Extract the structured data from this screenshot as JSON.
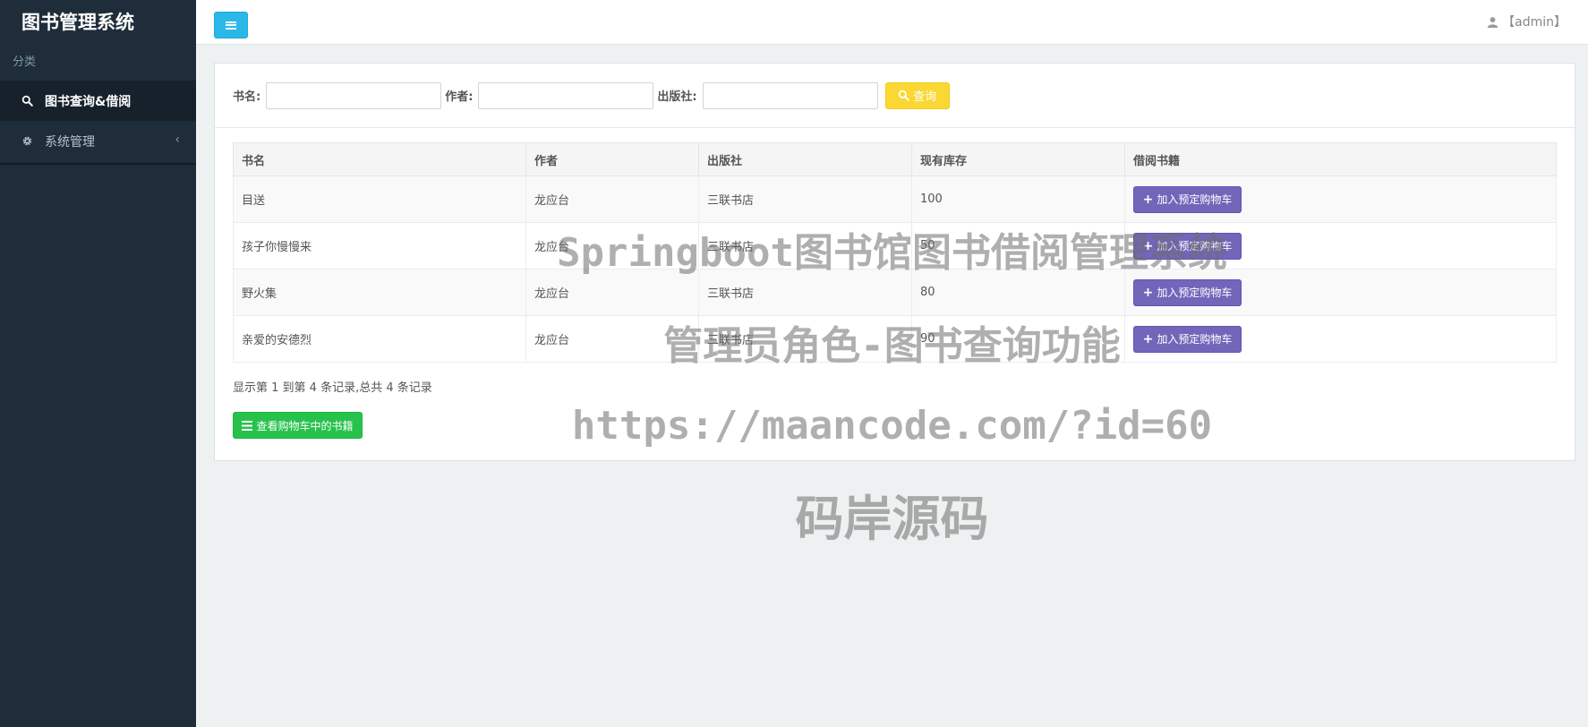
{
  "sidebar": {
    "brand": "图书管理系统",
    "section_label": "分类",
    "items": [
      {
        "label": "图书查询&借阅",
        "icon": "search-icon",
        "active": true
      },
      {
        "label": "系统管理",
        "icon": "gear-icon",
        "chevron": "‹"
      }
    ]
  },
  "header": {
    "toggle_icon": "menu-icon",
    "user_label": "【admin】"
  },
  "search": {
    "title_label": "书名:",
    "title_value": "",
    "author_label": "作者:",
    "author_value": "",
    "publisher_label": "出版社:",
    "publisher_value": "",
    "query_button": "查询"
  },
  "table": {
    "columns": [
      "书名",
      "作者",
      "出版社",
      "现有库存",
      "借阅书籍"
    ],
    "rows": [
      {
        "title": "目送",
        "author": "龙应台",
        "publisher": "三联书店",
        "stock": "100",
        "action": "加入预定购物车"
      },
      {
        "title": "孩子你慢慢来",
        "author": "龙应台",
        "publisher": "三联书店",
        "stock": "50",
        "action": "加入预定购物车"
      },
      {
        "title": "野火集",
        "author": "龙应台",
        "publisher": "三联书店",
        "stock": "80",
        "action": "加入预定购物车"
      },
      {
        "title": "亲爱的安德烈",
        "author": "龙应台",
        "publisher": "三联书店",
        "stock": "90",
        "action": "加入预定购物车"
      }
    ]
  },
  "pager_info": "显示第 1 到第 4 条记录,总共 4 条记录",
  "cart_button": "查看购物车中的书籍",
  "watermark": {
    "line1": "Springboot图书馆图书借阅管理系统",
    "line2": "管理员角色-图书查询功能",
    "line3": "https://maancode.com/?id=60",
    "line4": "码岸源码"
  },
  "colors": {
    "sidebar_bg": "#1f2d3a",
    "toggle": "#29b8e8",
    "query": "#fad733",
    "add": "#7266ba",
    "cart": "#27c24c"
  }
}
